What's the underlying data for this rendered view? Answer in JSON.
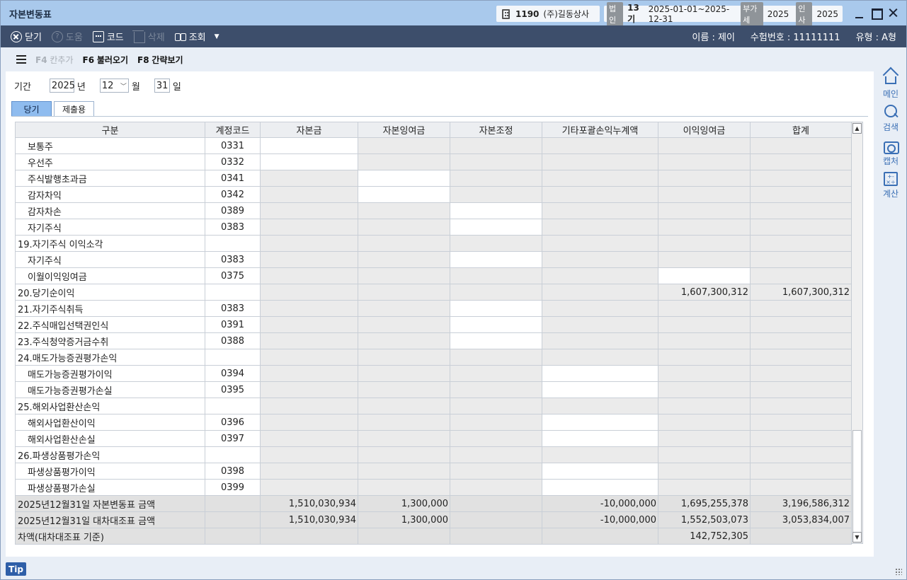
{
  "window": {
    "title": "자본변동표",
    "company_code": "1190",
    "company_name": "(주)길동상사",
    "corp_tag": "법인",
    "term": "13기",
    "period": "2025-01-01~2025-12-31",
    "vat_tag": "부가세",
    "vat_year": "2025",
    "hr_tag": "인사",
    "hr_year": "2025"
  },
  "toolbar": {
    "close_label": "닫기",
    "help_label": "도움",
    "code_label": "코드",
    "delete_label": "삭제",
    "query_label": "조회",
    "more_label": "▼",
    "name_label": "이름 : 제이",
    "exam_label": "수험번호 : 11111111",
    "type_label": "유형 : A형"
  },
  "fkeys": [
    {
      "key": "F4",
      "label": "칸추가",
      "disabled": true
    },
    {
      "key": "F6",
      "label": "불러오기",
      "disabled": false
    },
    {
      "key": "F8",
      "label": "간략보기",
      "disabled": false
    }
  ],
  "period": {
    "label": "기간",
    "year": "2025",
    "year_unit": "년",
    "month": "12",
    "month_unit": "월",
    "day": "31",
    "day_unit": "일"
  },
  "tabs": [
    "당기",
    "제출용"
  ],
  "columns": [
    "구분",
    "계정코드",
    "자본금",
    "자본잉여금",
    "자본조정",
    "기타포괄손익누계액",
    "이익잉여금",
    "합계"
  ],
  "rows": [
    {
      "label": "보통주",
      "indent": true,
      "code": "0331",
      "cells": [
        "",
        "",
        "",
        "",
        "",
        ""
      ],
      "white": [
        0
      ]
    },
    {
      "label": "우선주",
      "indent": true,
      "code": "0332",
      "cells": [
        "",
        "",
        "",
        "",
        "",
        ""
      ],
      "white": [
        0
      ]
    },
    {
      "label": "주식발행초과금",
      "indent": true,
      "code": "0341",
      "cells": [
        "",
        "",
        "",
        "",
        "",
        ""
      ],
      "white": [
        1
      ]
    },
    {
      "label": "감자차익",
      "indent": true,
      "code": "0342",
      "cells": [
        "",
        "",
        "",
        "",
        "",
        ""
      ],
      "white": [
        1
      ]
    },
    {
      "label": "감자차손",
      "indent": true,
      "code": "0389",
      "cells": [
        "",
        "",
        "",
        "",
        "",
        ""
      ],
      "white": [
        2
      ]
    },
    {
      "label": "자기주식",
      "indent": true,
      "code": "0383",
      "cells": [
        "",
        "",
        "",
        "",
        "",
        ""
      ],
      "white": [
        2
      ]
    },
    {
      "label": "19.자기주식 이익소각",
      "indent": false,
      "code": "",
      "cells": [
        "",
        "",
        "",
        "",
        "",
        ""
      ],
      "white": []
    },
    {
      "label": "자기주식",
      "indent": true,
      "code": "0383",
      "cells": [
        "",
        "",
        "",
        "",
        "",
        ""
      ],
      "white": [
        2
      ]
    },
    {
      "label": "이월이익잉여금",
      "indent": true,
      "code": "0375",
      "cells": [
        "",
        "",
        "",
        "",
        "",
        ""
      ],
      "white": [
        4
      ]
    },
    {
      "label": "20.당기순이익",
      "indent": false,
      "code": "",
      "cells": [
        "",
        "",
        "",
        "",
        "1,607,300,312",
        "1,607,300,312"
      ],
      "white": []
    },
    {
      "label": "21.자기주식취득",
      "indent": false,
      "code": "0383",
      "cells": [
        "",
        "",
        "",
        "",
        "",
        ""
      ],
      "white": [
        2
      ]
    },
    {
      "label": "22.주식매입선택권인식",
      "indent": false,
      "code": "0391",
      "cells": [
        "",
        "",
        "",
        "",
        "",
        ""
      ],
      "white": [
        2
      ]
    },
    {
      "label": "23.주식청약증거금수취",
      "indent": false,
      "code": "0388",
      "cells": [
        "",
        "",
        "",
        "",
        "",
        ""
      ],
      "white": [
        2
      ]
    },
    {
      "label": "24.매도가능증권평가손익",
      "indent": false,
      "code": "",
      "cells": [
        "",
        "",
        "",
        "",
        "",
        ""
      ],
      "white": []
    },
    {
      "label": "매도가능증권평가이익",
      "indent": true,
      "code": "0394",
      "cells": [
        "",
        "",
        "",
        "",
        "",
        ""
      ],
      "white": [
        3
      ]
    },
    {
      "label": "매도가능증권평가손실",
      "indent": true,
      "code": "0395",
      "cells": [
        "",
        "",
        "",
        "",
        "",
        ""
      ],
      "white": [
        3
      ]
    },
    {
      "label": "25.해외사업환산손익",
      "indent": false,
      "code": "",
      "cells": [
        "",
        "",
        "",
        "",
        "",
        ""
      ],
      "white": []
    },
    {
      "label": "해외사업환산이익",
      "indent": true,
      "code": "0396",
      "cells": [
        "",
        "",
        "",
        "",
        "",
        ""
      ],
      "white": [
        3
      ]
    },
    {
      "label": "해외사업환산손실",
      "indent": true,
      "code": "0397",
      "cells": [
        "",
        "",
        "",
        "",
        "",
        ""
      ],
      "white": [
        3
      ]
    },
    {
      "label": "26.파생상품평가손익",
      "indent": false,
      "code": "",
      "cells": [
        "",
        "",
        "",
        "",
        "",
        ""
      ],
      "white": []
    },
    {
      "label": "파생상품평가이익",
      "indent": true,
      "code": "0398",
      "cells": [
        "",
        "",
        "",
        "",
        "",
        ""
      ],
      "white": [
        3
      ]
    },
    {
      "label": "파생상품평가손실",
      "indent": true,
      "code": "0399",
      "cells": [
        "",
        "",
        "",
        "",
        "",
        ""
      ],
      "white": [
        3
      ]
    },
    {
      "label": "2025년12월31일 자본변동표 금액",
      "indent": false,
      "code": "",
      "total": true,
      "cells": [
        "1,510,030,934",
        "1,300,000",
        "",
        "-10,000,000",
        "1,695,255,378",
        "3,196,586,312"
      ],
      "white": []
    },
    {
      "label": "2025년12월31일 대차대조표 금액",
      "indent": false,
      "code": "",
      "total": true,
      "cells": [
        "1,510,030,934",
        "1,300,000",
        "",
        "-10,000,000",
        "1,552,503,073",
        "3,053,834,007"
      ],
      "white": []
    },
    {
      "label": "차액(대차대조표 기준)",
      "indent": false,
      "code": "",
      "total": true,
      "cells": [
        "",
        "",
        "",
        "",
        "142,752,305",
        ""
      ],
      "white": []
    }
  ],
  "side_menu": [
    {
      "label": "메인",
      "icon": "home-icon"
    },
    {
      "label": "검색",
      "icon": "search-icon"
    },
    {
      "label": "캡처",
      "icon": "camera-icon"
    },
    {
      "label": "계산",
      "icon": "calculator-icon"
    }
  ],
  "status": {
    "tip_label": "Tip"
  }
}
